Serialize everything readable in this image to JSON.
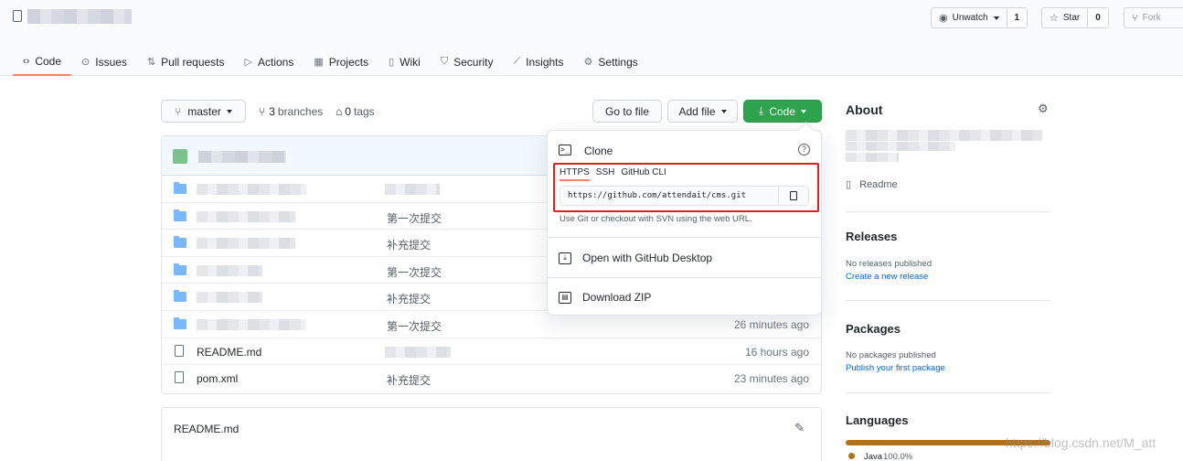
{
  "header": {
    "unwatch_label": "Unwatch",
    "watch_count": "1",
    "star_label": "Star",
    "star_count": "0",
    "fork_label": "Fork"
  },
  "tabs": [
    {
      "label": "Code",
      "icon": "code-icon"
    },
    {
      "label": "Issues",
      "icon": "issue-icon"
    },
    {
      "label": "Pull requests",
      "icon": "pull-request-icon"
    },
    {
      "label": "Actions",
      "icon": "play-icon"
    },
    {
      "label": "Projects",
      "icon": "project-icon"
    },
    {
      "label": "Wiki",
      "icon": "book-icon"
    },
    {
      "label": "Security",
      "icon": "shield-icon"
    },
    {
      "label": "Insights",
      "icon": "graph-icon"
    },
    {
      "label": "Settings",
      "icon": "gear-icon"
    }
  ],
  "toolbar": {
    "branch": "master",
    "branches_count": "3",
    "branches_label": "branches",
    "tags_count": "0",
    "tags_label": "tags",
    "go_to_file": "Go to file",
    "add_file": "Add file",
    "code": "Code"
  },
  "files": [
    {
      "type": "folder",
      "name": "",
      "message": "",
      "age": ""
    },
    {
      "type": "folder",
      "name": "",
      "message": "第一次提交",
      "age": ""
    },
    {
      "type": "folder",
      "name": "",
      "message": "补充提交",
      "age": ""
    },
    {
      "type": "folder",
      "name": "",
      "message": "第一次提交",
      "age": ""
    },
    {
      "type": "folder",
      "name": "",
      "message": "补充提交",
      "age": ""
    },
    {
      "type": "folder",
      "name": "",
      "message": "第一次提交",
      "age": "26 minutes ago"
    },
    {
      "type": "file",
      "name": "README.md",
      "message": "",
      "age": "16 hours ago"
    },
    {
      "type": "file",
      "name": "pom.xml",
      "message": "补充提交",
      "age": "23 minutes ago"
    }
  ],
  "readme": {
    "title": "README.md"
  },
  "clone": {
    "title": "Clone",
    "protocols": [
      "HTTPS",
      "SSH",
      "GitHub CLI"
    ],
    "url": "https://github.com/attendait/cms.git",
    "hint": "Use Git or checkout with SVN using the web URL.",
    "open_desktop": "Open with GitHub Desktop",
    "download_zip": "Download ZIP"
  },
  "sidebar": {
    "about": "About",
    "readme_link": "Readme",
    "releases_title": "Releases",
    "releases_text": "No releases published",
    "releases_link": "Create a new release",
    "packages_title": "Packages",
    "packages_text": "No packages published",
    "packages_link": "Publish your first package",
    "languages_title": "Languages",
    "language_name": "Java",
    "language_pct": "100.0%"
  },
  "watermark": "https://blog.csdn.net/M_att",
  "colors": {
    "accent_tab": "#f9826c",
    "code_button": "#2ea44f",
    "highlight_box": "#e02020",
    "java": "#b07219"
  }
}
